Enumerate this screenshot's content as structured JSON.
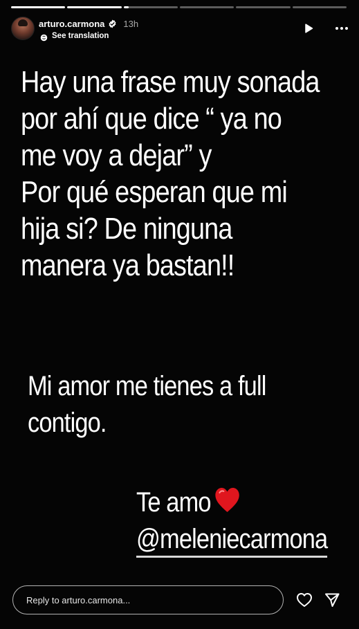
{
  "progress": {
    "segments": [
      1,
      1,
      0.1,
      0,
      0,
      0
    ],
    "active_color": "#ffffff",
    "inactive_color": "rgba(255,255,255,0.35)"
  },
  "header": {
    "username": "arturo.carmona",
    "verified_icon": "verified-badge-icon",
    "time": "13h",
    "see_translation": "See translation",
    "play_icon": "play-icon",
    "more_icon": "more-icon"
  },
  "story": {
    "paragraph1": [
      "Hay una frase muy sonada",
      "por ahí que dice “ ya no",
      "me voy a dejar”  y",
      "Por qué esperan que mi",
      "hija si? De ninguna",
      "manera ya bastan!!"
    ],
    "paragraph2": [
      "Mi amor me tienes a full",
      "contigo."
    ],
    "paragraph3_line1": "Te amo",
    "heart_emoji_icon": "red-heart-icon",
    "mention": "@meleniecarmona"
  },
  "footer": {
    "reply_placeholder": "Reply to arturo.carmona...",
    "like_icon": "heart-outline-icon",
    "share_icon": "send-icon"
  }
}
